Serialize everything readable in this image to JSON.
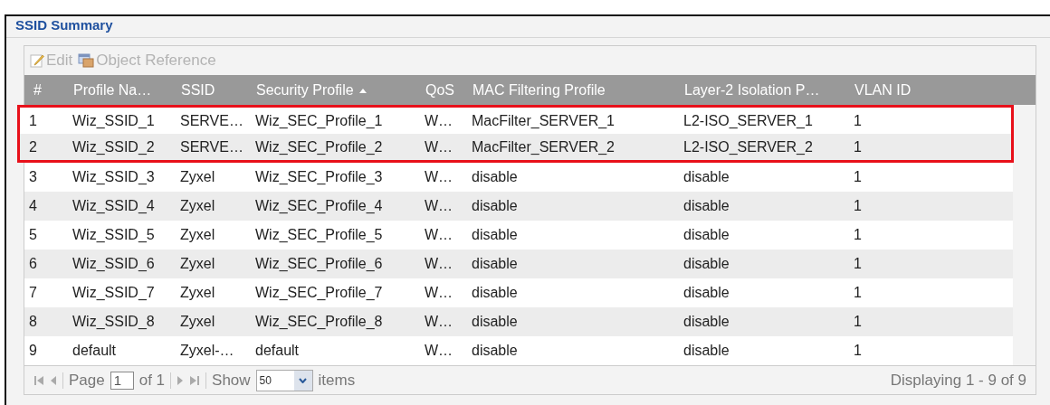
{
  "panel": {
    "title": "SSID Summary"
  },
  "toolbar": [
    {
      "kind": "edit",
      "label": "Edit",
      "disabled": true
    },
    {
      "kind": "reference",
      "label": "Object Reference",
      "disabled": true
    }
  ],
  "table": {
    "columns": [
      {
        "label": "#",
        "sorted": false
      },
      {
        "label": "Profile Na…",
        "sorted": false
      },
      {
        "label": "SSID",
        "sorted": false
      },
      {
        "label": "Security Profile",
        "sorted": true
      },
      {
        "label": "QoS",
        "sorted": false
      },
      {
        "label": "MAC Filtering Profile",
        "sorted": false
      },
      {
        "label": "Layer-2 Isolation P…",
        "sorted": false
      },
      {
        "label": "VLAN ID",
        "sorted": false
      }
    ],
    "rows": [
      {
        "highlighted": true,
        "cells": [
          "1",
          "Wiz_SSID_1",
          "SERVE…",
          "Wiz_SEC_Profile_1",
          "W…",
          "MacFilter_SERVER_1",
          "L2-ISO_SERVER_1",
          "1"
        ]
      },
      {
        "highlighted": true,
        "cells": [
          "2",
          "Wiz_SSID_2",
          "SERVE…",
          "Wiz_SEC_Profile_2",
          "W…",
          "MacFilter_SERVER_2",
          "L2-ISO_SERVER_2",
          "1"
        ]
      },
      {
        "highlighted": false,
        "cells": [
          "3",
          "Wiz_SSID_3",
          "Zyxel",
          "Wiz_SEC_Profile_3",
          "W…",
          "disable",
          "disable",
          "1"
        ]
      },
      {
        "highlighted": false,
        "cells": [
          "4",
          "Wiz_SSID_4",
          "Zyxel",
          "Wiz_SEC_Profile_4",
          "W…",
          "disable",
          "disable",
          "1"
        ]
      },
      {
        "highlighted": false,
        "cells": [
          "5",
          "Wiz_SSID_5",
          "Zyxel",
          "Wiz_SEC_Profile_5",
          "W…",
          "disable",
          "disable",
          "1"
        ]
      },
      {
        "highlighted": false,
        "cells": [
          "6",
          "Wiz_SSID_6",
          "Zyxel",
          "Wiz_SEC_Profile_6",
          "W…",
          "disable",
          "disable",
          "1"
        ]
      },
      {
        "highlighted": false,
        "cells": [
          "7",
          "Wiz_SSID_7",
          "Zyxel",
          "Wiz_SEC_Profile_7",
          "W…",
          "disable",
          "disable",
          "1"
        ]
      },
      {
        "highlighted": false,
        "cells": [
          "8",
          "Wiz_SSID_8",
          "Zyxel",
          "Wiz_SEC_Profile_8",
          "W…",
          "disable",
          "disable",
          "1"
        ]
      },
      {
        "highlighted": false,
        "cells": [
          "9",
          "default",
          "Zyxel-…",
          "default",
          "W…",
          "disable",
          "disable",
          "1"
        ]
      }
    ]
  },
  "pager": {
    "page_label": "Page",
    "page": "1",
    "of_label": "of 1",
    "show_label": "Show",
    "page_size": "50",
    "items_label": "items",
    "summary": "Displaying 1 - 9 of 9"
  }
}
